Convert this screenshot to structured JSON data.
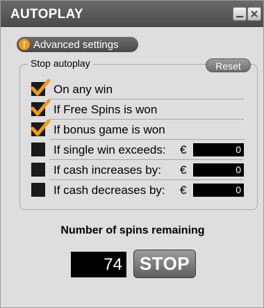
{
  "window": {
    "title": "AUTOPLAY"
  },
  "advanced": {
    "label": "Advanced settings",
    "icon": "warning-icon"
  },
  "stop_autoplay": {
    "legend": "Stop autoplay",
    "reset_label": "Reset",
    "options": [
      {
        "label": "On any win",
        "checked": true
      },
      {
        "label": "If Free Spins is won",
        "checked": true
      },
      {
        "label": "If bonus game is won",
        "checked": true
      },
      {
        "label": "If single win exceeds:",
        "checked": false,
        "currency": "€",
        "value": "0"
      },
      {
        "label": "If cash increases by:",
        "checked": false,
        "currency": "€",
        "value": "0"
      },
      {
        "label": "If cash decreases by:",
        "checked": false,
        "currency": "€",
        "value": "0"
      }
    ]
  },
  "spins": {
    "title": "Number of spins remaining",
    "count": "74",
    "stop_label": "STOP"
  },
  "colors": {
    "titlebar": "#4f4f4f",
    "panel": "#dedede",
    "check": "#f39a1a"
  }
}
